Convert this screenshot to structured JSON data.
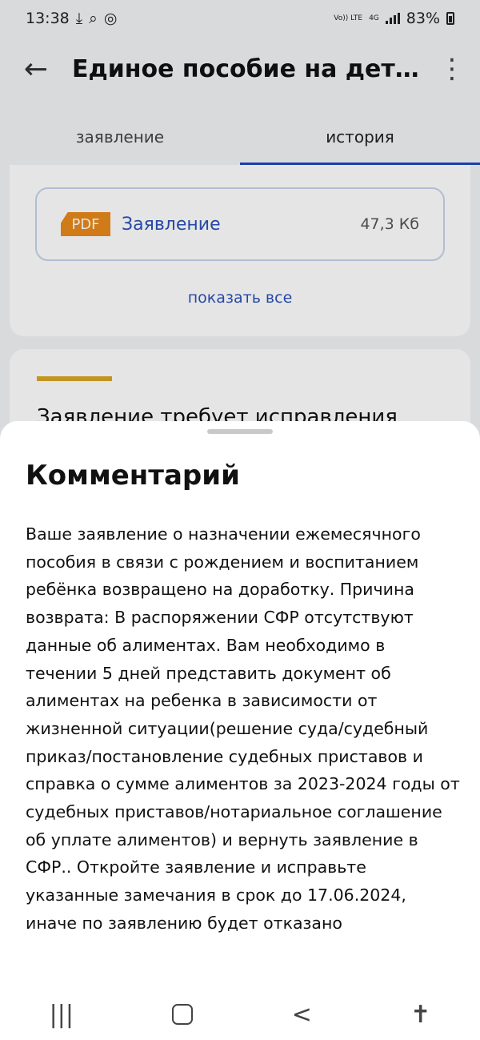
{
  "status_bar": {
    "time": "13:38",
    "icons": [
      "download-icon",
      "search-icon",
      "fingerprint-icon"
    ],
    "network": {
      "volte": "Vo)) LTE",
      "type": "4G"
    },
    "battery": "83%"
  },
  "app_bar": {
    "title": "Единое пособие на дете..."
  },
  "tabs": [
    {
      "label": "заявление",
      "active": false
    },
    {
      "label": "история",
      "active": true
    }
  ],
  "document": {
    "badge": "PDF",
    "name": "Заявление",
    "size": "47,3 Кб",
    "show_all": "показать все"
  },
  "status_card": {
    "title": "Заявление требует исправления",
    "accent": "#d9a626"
  },
  "sheet": {
    "title": "Комментарий",
    "body": "Ваше заявление о назначении ежемесячного пособия в связи с рождением и воспитанием ребёнка возвращено на доработку. Причина возврата: В распоряжении СФР отсутствуют данные об алиментах. Вам необходимо в течении 5 дней представить документ об алиментах на ребенка в зависимости от жизненной ситуации(решение суда/судебный приказ/постановление судебных приставов и справка о сумме алиментов за 2023-2024 годы от судебных приставов/нотариальное соглашение об уплате алиментов) и вернуть заявление в СФР.. Откройте заявление и исправьте указанные замечания в срок до 17.06.2024, иначе по заявлению будет отказано"
  },
  "nav_bar": {
    "icons": [
      "recents-icon",
      "home-icon",
      "back-icon",
      "accessibility-icon"
    ]
  },
  "colors": {
    "accent": "#2c52b8",
    "tab_indicator": "#1c47c0",
    "pdf_badge": "#e88a1a"
  }
}
